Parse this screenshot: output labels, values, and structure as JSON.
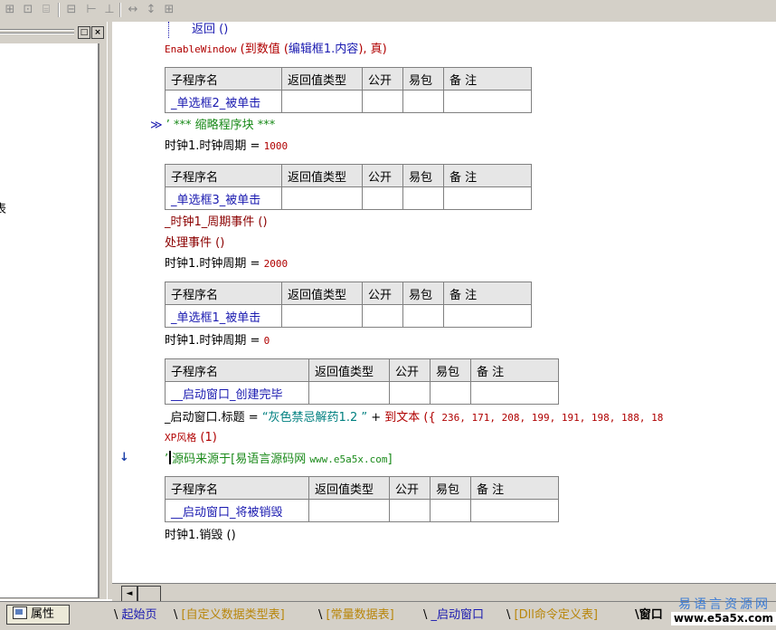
{
  "toolbar": {
    "icons": [
      "table-icon",
      "table-insert-icon",
      "table-format-icon",
      "table-merge-icon",
      "column-width-icon",
      "row-height-icon",
      "fit-width-icon",
      "fit-height-icon",
      "grid-icon"
    ]
  },
  "left_panel": {
    "restore_glyph": "□",
    "close_glyph": "×",
    "truncated_label": "表"
  },
  "code": {
    "l1_fn": "返回 ()",
    "l2_fn": "EnableWindow",
    "l2_args_open": " (到数值 (",
    "l2_arg": "编辑框1.内容",
    "l2_args_close": "), 真)",
    "fold_marker": "≫",
    "fold_text": "’ *** 缩略程序块 ***",
    "set1_obj": "时钟1.时钟周期",
    "set1_op": " = ",
    "set1_val": "1000",
    "call1": "_时钟1_周期事件 ()",
    "call2": "处理事件 ()",
    "set2_obj": "时钟1.时钟周期",
    "set2_op": " = ",
    "set2_val": "2000",
    "set3_obj": "时钟1.时钟周期",
    "set3_op": " = ",
    "set3_val": "0",
    "title_obj": "_启动窗口.标题",
    "title_op": " = ",
    "title_str": "“灰色禁忌解药1.2  ”",
    "title_plus": " + ",
    "title_fn": "到文本 ({",
    "title_nums": " 236, 171, 208, 199, 191, 198, 188, 18",
    "xp_fn": "XP风格",
    "xp_arg": " (1)",
    "comment_mark": "’",
    "comment_text": "源码来源于[易语言源码网 ",
    "comment_url": "www.e5a5x.com",
    "comment_close": "]",
    "destroy": "时钟1.销毁 ()",
    "gutter_arrow": "↓"
  },
  "table_headers": [
    "子程序名",
    "返回值类型",
    "公开",
    "易包",
    "备 注"
  ],
  "subroutines": [
    {
      "name": "_单选框2_被单击"
    },
    {
      "name": "_单选框3_被单击"
    },
    {
      "name": "_单选框1_被单击"
    },
    {
      "name": "__启动窗口_创建完毕"
    },
    {
      "name": "__启动窗口_将被销毁"
    }
  ],
  "bottom": {
    "props_label": "属性",
    "tabs": [
      "起始页",
      "[自定义数据类型表]",
      "[常量数据表]",
      "_启动窗口",
      "[Dll命令定义表]",
      "窗口"
    ],
    "scroll_left": "◄",
    "watermark_cn": "易语言资源网",
    "watermark_url": "www.e5a5x.com"
  }
}
